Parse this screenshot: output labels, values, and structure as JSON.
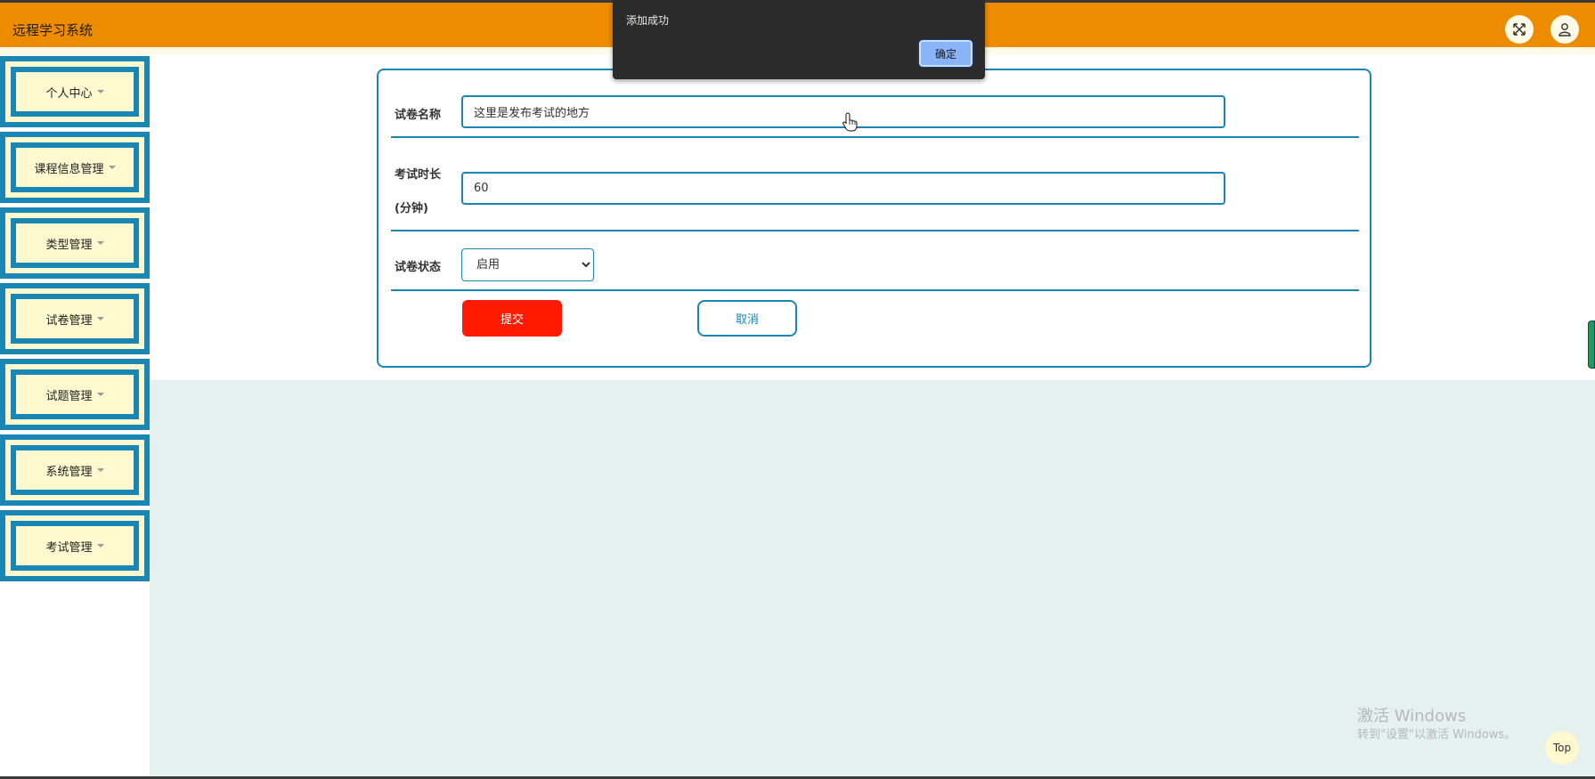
{
  "header": {
    "title": "远程学习系统",
    "fullscreen_icon": "expand-icon",
    "user_icon": "user-icon"
  },
  "sidebar": {
    "items": [
      {
        "label": "个人中心"
      },
      {
        "label": "课程信息管理"
      },
      {
        "label": "类型管理"
      },
      {
        "label": "试卷管理"
      },
      {
        "label": "试题管理"
      },
      {
        "label": "系统管理"
      },
      {
        "label": "考试管理"
      }
    ]
  },
  "form": {
    "name_label": "试卷名称",
    "name_value": "这里是发布考试的地方",
    "duration_label_line1": "考试时长",
    "duration_label_line2": "(分钟)",
    "duration_value": "60",
    "status_label": "试卷状态",
    "status_value": "启用",
    "submit_label": "提交",
    "cancel_label": "取消"
  },
  "alert": {
    "message": "添加成功",
    "ok_label": "确定"
  },
  "watermark": {
    "line1": "激活 Windows",
    "line2": "转到\"设置\"以激活 Windows。"
  },
  "top_button": "Top",
  "colors": {
    "header": "#ee8c00",
    "accent": "#1a86b4",
    "menu_fill": "#fff9d0",
    "submit": "#ff1a00",
    "content_bg": "#e4f1ee"
  }
}
